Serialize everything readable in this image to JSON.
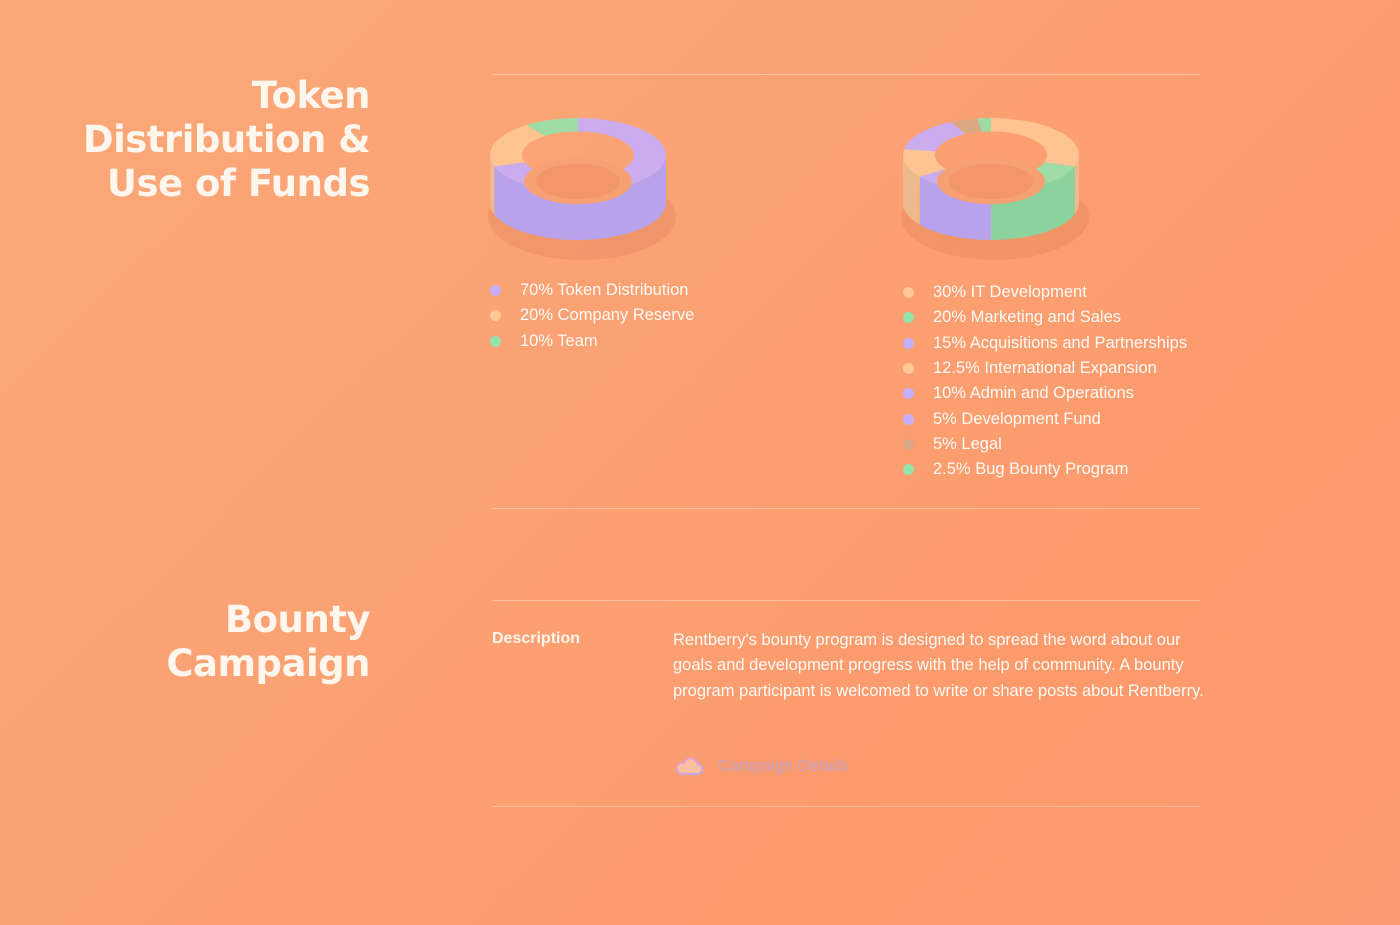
{
  "sections": {
    "token": {
      "title_lines": [
        "Token",
        "Distribution &",
        "Use of Funds"
      ]
    },
    "bounty": {
      "title_lines": [
        "Bounty",
        "Campaign"
      ],
      "description_label": "Description",
      "description_text": "Rentberry's bounty program is designed to spread the word about our goals and development progress with the help of community. A bounty program participant is welcomed to write or share posts about Rentberry.",
      "campaign_link": "Campaign Details",
      "campaign_icon": "cloud-icon"
    }
  },
  "colors": {
    "purple": "#c5aefd",
    "orange": "#ffc896",
    "green": "#95e2ab",
    "brown": "#d8a888",
    "link": "#c7a3c3"
  },
  "chart_data": [
    {
      "type": "pie",
      "style": "3d-donut",
      "title": "",
      "categories": [
        "Token Distribution",
        "Company Reserve",
        "Team"
      ],
      "values": [
        70,
        20,
        10
      ],
      "legend_labels": [
        "70% Token Distribution",
        "20% Company Reserve",
        "10% Team"
      ],
      "colors": [
        "#c5aefd",
        "#ffc896",
        "#95e2ab"
      ],
      "legend_placement": "bottom"
    },
    {
      "type": "pie",
      "style": "3d-donut",
      "title": "",
      "categories": [
        "IT Development",
        "Marketing and Sales",
        "Acquisitions and Partnerships",
        "International Expansion",
        "Admin and Operations",
        "Development Fund",
        "Legal",
        "Bug Bounty Program"
      ],
      "values": [
        30,
        20,
        15,
        12.5,
        10,
        5,
        5,
        2.5
      ],
      "legend_labels": [
        "30% IT Development",
        "20% Marketing and Sales",
        "15% Acquisitions and Partnerships",
        "12.5% International Expansion",
        "10% Admin and Operations",
        "5% Development Fund",
        "5% Legal",
        "2.5% Bug Bounty Program"
      ],
      "colors": [
        "#ffc896",
        "#95e2ab",
        "#c5aefd",
        "#ffc896",
        "#c5aefd",
        "#c5aefd",
        "#d8a888",
        "#95e2ab"
      ],
      "legend_placement": "bottom"
    }
  ]
}
